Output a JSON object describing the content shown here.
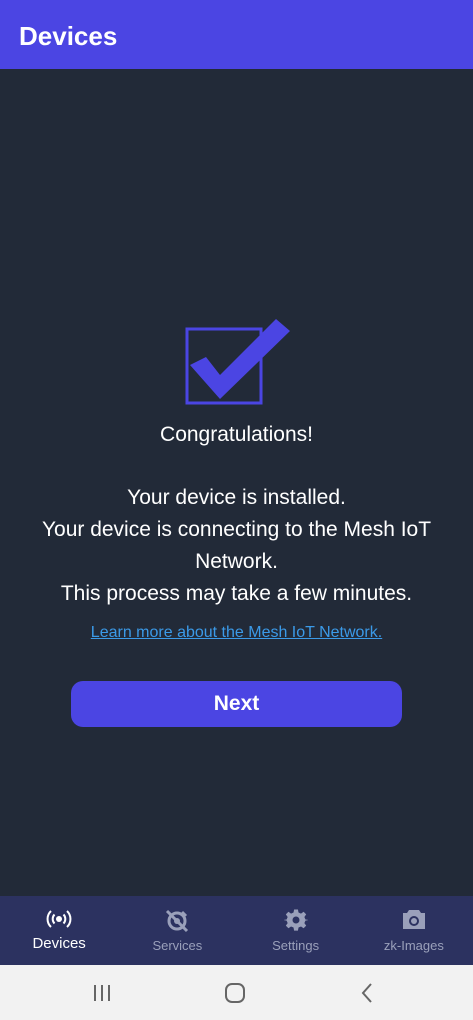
{
  "app_bar": {
    "title": "Devices"
  },
  "main": {
    "icon": "checkbox-checked-icon",
    "congrats": "Congratulations!",
    "message_lines": [
      "Your device is installed.",
      "Your device is connecting to the Mesh IoT Network.",
      "This process may take a few minutes."
    ],
    "learn_link": "Learn more about the Mesh IoT Network.",
    "next_label": "Next"
  },
  "bottom_nav": {
    "items": [
      {
        "label": "Devices",
        "icon": "broadcast-icon",
        "active": true
      },
      {
        "label": "Services",
        "icon": "services-icon",
        "active": false
      },
      {
        "label": "Settings",
        "icon": "gear-icon",
        "active": false
      },
      {
        "label": "zk-Images",
        "icon": "camera-icon",
        "active": false
      }
    ]
  },
  "system_nav": {
    "buttons": [
      "recent-apps-icon",
      "home-icon",
      "back-icon"
    ]
  },
  "colors": {
    "accent": "#4b45e3",
    "background": "#222a38",
    "nav_background": "#2c3260",
    "link": "#3b9ae8"
  }
}
